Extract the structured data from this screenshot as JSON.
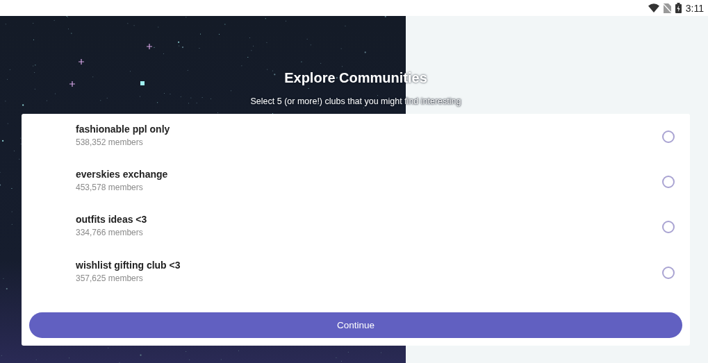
{
  "status_bar": {
    "time": "3:11"
  },
  "title": "Explore Communities",
  "subtitle": "Select 5 (or more!) clubs that you might find interesting",
  "clubs": [
    {
      "name": "fashionable ppl only",
      "members": "538,352 members",
      "selected": false
    },
    {
      "name": "everskies exchange",
      "members": "453,578 members",
      "selected": false
    },
    {
      "name": "outfits ideas <3",
      "members": "334,766 members",
      "selected": false
    },
    {
      "name": "wishlist gifting club <3",
      "members": "357,625 members",
      "selected": false
    }
  ],
  "continue_button": "Continue"
}
